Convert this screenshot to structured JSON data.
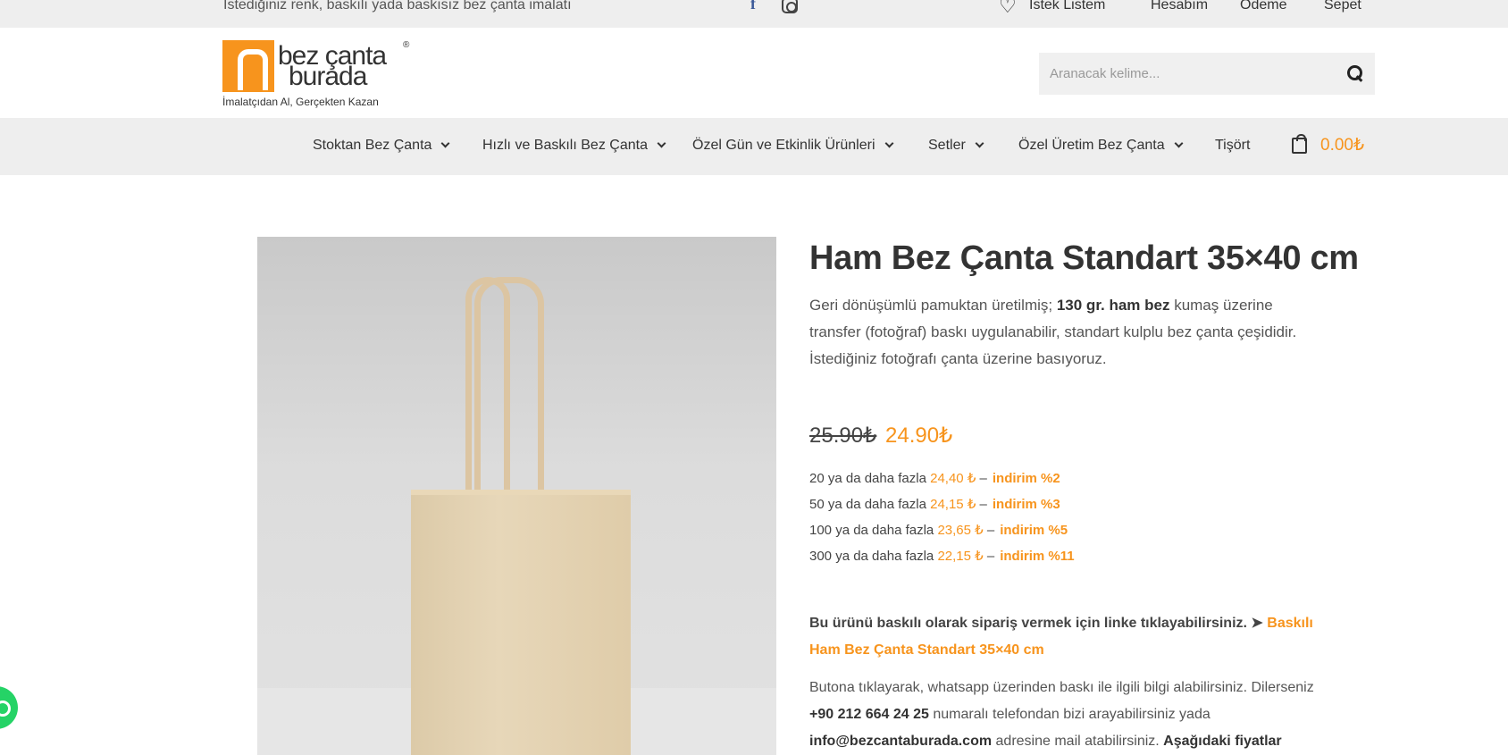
{
  "topbar": {
    "tagline": "İstediğiniz renk, baskılı yada baskısız bez çanta imalatı",
    "social_icons": [
      "facebook-icon",
      "instagram-icon"
    ],
    "wishlist_label": "İstek Listem",
    "account_label": "Hesabım",
    "checkout_label": "Ödeme",
    "cart_label": "Sepet"
  },
  "header": {
    "logo": {
      "word1": "bez çanta",
      "word2": "burada",
      "tagline": "İmalatçıdan Al, Gerçekten Kazan"
    },
    "search": {
      "placeholder": "Aranacak kelime..."
    }
  },
  "nav": {
    "items": [
      {
        "label": "Stoktan Bez Çanta",
        "has_dropdown": true
      },
      {
        "label": "Hızlı ve Baskılı Bez Çanta",
        "has_dropdown": true
      },
      {
        "label": "Özel Gün ve Etkinlik Ürünleri",
        "has_dropdown": true
      },
      {
        "label": "Setler",
        "has_dropdown": true
      },
      {
        "label": "Özel Üretim Bez Çanta",
        "has_dropdown": true
      },
      {
        "label": "Tişört",
        "has_dropdown": false
      }
    ],
    "cart_total": "0.00₺"
  },
  "product": {
    "title": "Ham Bez Çanta Standart 35×40 cm",
    "desc_part1": "Geri dönüşümlü pamuktan üretilmiş; ",
    "desc_bold": "130 gr. ham bez",
    "desc_part2": " kumaş üzerine transfer (fotoğraf) baskı uygulanabilir, standart kulplu bez çanta çeşididir. İstediğiniz fotoğrafı çanta üzerine basıyoruz.",
    "price_old": "25.90₺",
    "price_new": "24.90₺",
    "tiers": [
      {
        "text": "20 ya da daha fazla",
        "price": "24,40 ₺",
        "sep": "–",
        "discount": "indirim %2"
      },
      {
        "text": "50 ya da daha fazla",
        "price": "24,15 ₺",
        "sep": "–",
        "discount": "indirim %3"
      },
      {
        "text": "100 ya da daha fazla",
        "price": "23,65 ₺",
        "sep": "–",
        "discount": "indirim %5"
      },
      {
        "text": "300 ya da daha fazla",
        "price": "22,15 ₺",
        "sep": "–",
        "discount": "indirim %11"
      }
    ],
    "cta_text": "Bu ürünü baskılı olarak sipariş vermek için linke tıklayabilirsiniz. ➤ ",
    "cta_link": "Baskılı Ham Bez Çanta Standart 35×40 cm",
    "info_part1": "Butona tıklayarak, whatsapp üzerinden baskı ile ilgili bilgi alabilirsiniz. Dilerseniz ",
    "info_phone": "+90 212 664 24 25",
    "info_part2": " numaralı telefondan bizi arayabilirsiniz yada ",
    "info_email": "info@bezcantaburada.com",
    "info_part3": " adresine mail atabilirsiniz. ",
    "info_bold_tail": "Aşağıdaki fiyatlar"
  },
  "colors": {
    "accent": "#f7941d",
    "bar_bg": "#eeeeee",
    "whatsapp": "#25d366"
  }
}
